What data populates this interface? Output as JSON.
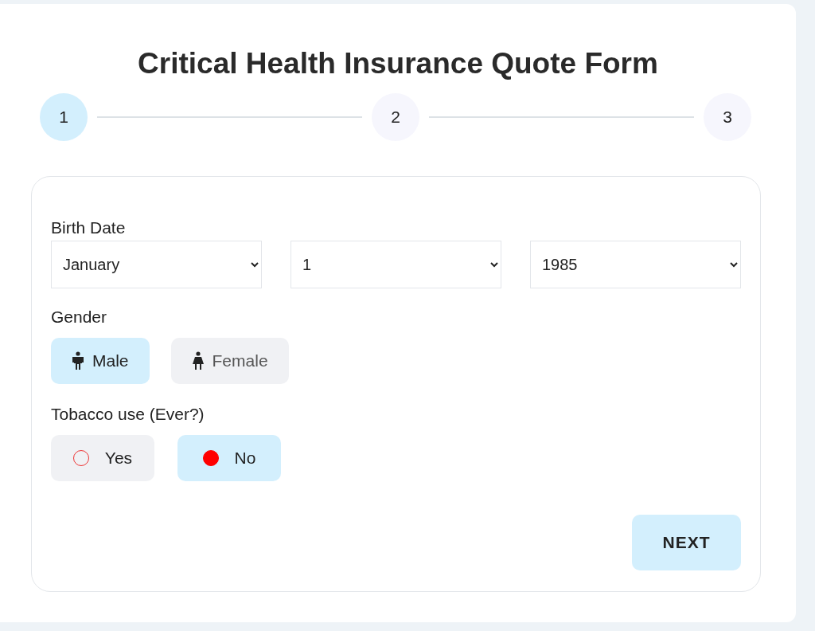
{
  "title": "Critical Health Insurance Quote Form",
  "steps": [
    {
      "label": "1",
      "selected": true
    },
    {
      "label": "2",
      "selected": false
    },
    {
      "label": "3",
      "selected": false
    }
  ],
  "form": {
    "birth_date": {
      "label": "Birth Date",
      "fields": [
        {
          "value": "January"
        },
        {
          "value": "1"
        },
        {
          "value": "1985"
        }
      ]
    },
    "gender": {
      "label": "Gender",
      "options": [
        {
          "kind": "male",
          "label": "Male",
          "selected": true
        },
        {
          "kind": "female",
          "label": "Female",
          "selected": false
        }
      ]
    },
    "tobacco": {
      "label": "Tobacco use (Ever?)",
      "options": [
        {
          "label": "Yes",
          "selected": false
        },
        {
          "label": "No",
          "selected": true
        }
      ]
    },
    "next_button": "NEXT"
  }
}
